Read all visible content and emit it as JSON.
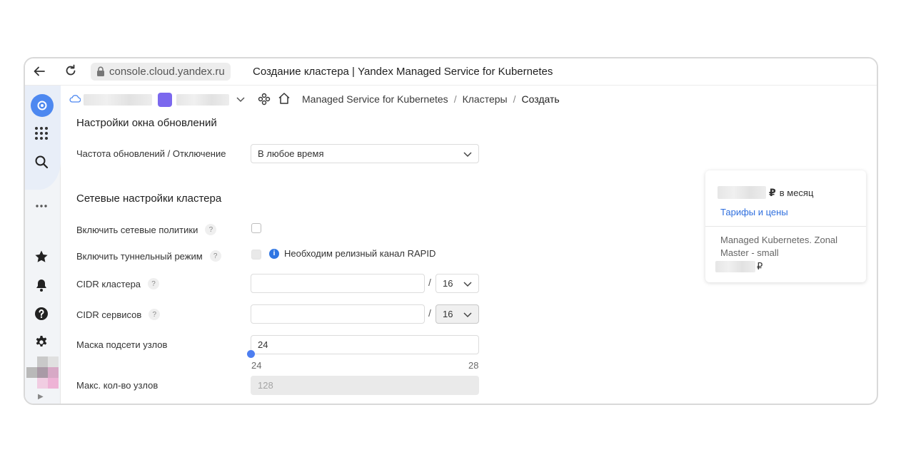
{
  "browser": {
    "url": "console.cloud.yandex.ru",
    "tab_title": "Создание кластера | Yandex Managed Service for Kubernetes"
  },
  "breadcrumbs": {
    "items": [
      "Managed Service for Kubernetes",
      "Кластеры"
    ],
    "current": "Создать"
  },
  "update_window": {
    "heading": "Настройки окна обновлений",
    "frequency_label": "Частота обновлений / Отключение",
    "frequency_value": "В любое время"
  },
  "network": {
    "heading": "Сетевые настройки кластера",
    "network_policies_label": "Включить сетевые политики",
    "tunnel_mode_label": "Включить туннельный режим",
    "tunnel_note": "Необходим релизный канал RAPID",
    "cluster_cidr_label": "CIDR кластера",
    "cluster_cidr_value": "",
    "cluster_cidr_mask": "16",
    "service_cidr_label": "CIDR сервисов",
    "service_cidr_value": "",
    "service_cidr_mask": "16",
    "node_mask_label": "Маска подсети узлов",
    "node_mask_value": "24",
    "node_mask_min": "24",
    "node_mask_max": "28",
    "node_mask_level": 0,
    "max_nodes_label": "Макс. кол-во узлов",
    "max_nodes_value": "128"
  },
  "help_mark": "?",
  "info_mark": "i",
  "price_card": {
    "per_month": "в месяц",
    "currency": "₽",
    "tariffs_link": "Тарифы и цены",
    "service_line": "Managed Kubernetes. Zonal Master - small"
  },
  "colors": {
    "accent": "#4d7ef0",
    "link": "#2f6fde",
    "folder": "#7b68ee"
  }
}
